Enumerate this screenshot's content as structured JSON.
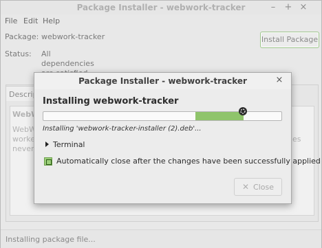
{
  "main": {
    "title": "Package Installer - webwork-tracker",
    "menu": [
      "File",
      "Edit",
      "Help"
    ],
    "package_label": "Package:",
    "package_value": "webwork-tracker",
    "status_label": "Status:",
    "status_lines": [
      "All",
      "dependencies",
      "are satisfied"
    ],
    "install_button": "Install Package",
    "description_tab": "Description",
    "description_title": "WebW",
    "description_lines": [
      "WebW",
      "worke",
      "never"
    ],
    "description_right": "es",
    "status_bar": "Installing package file..."
  },
  "dialog": {
    "title": "Package Installer - webwork-tracker",
    "heading": "Installing webwork-tracker",
    "progress": {
      "start_fraction": 0.64,
      "end_fraction": 0.84
    },
    "install_text": "Installing 'webwork-tracker-installer (2).deb'...",
    "terminal_label": "Terminal",
    "auto_close_label": "Automatically close after the changes have been successfully applied",
    "auto_close_checked": true,
    "close_button": "Close"
  },
  "colors": {
    "accent_green": "#8fc46b",
    "checkbox_green": "#9ccf7a"
  },
  "icons": [
    "minimize-icon",
    "maximize-icon",
    "close-icon",
    "chevron-right-icon",
    "busy-cursor-icon",
    "x-icon"
  ]
}
